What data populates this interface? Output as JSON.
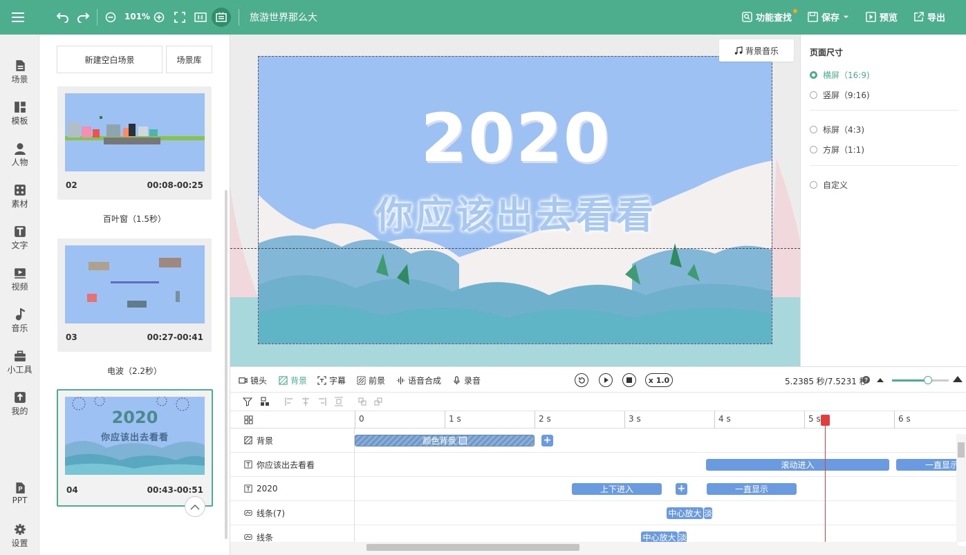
{
  "topbar": {
    "zoom": "101%",
    "doc_title": "旅游世界那么大",
    "feature_search": "功能查找",
    "save": "保存",
    "preview": "预览",
    "export": "导出"
  },
  "nav": [
    {
      "label": "场景",
      "icon": "scene-icon"
    },
    {
      "label": "模板",
      "icon": "template-icon"
    },
    {
      "label": "人物",
      "icon": "person-icon"
    },
    {
      "label": "素材",
      "icon": "material-icon"
    },
    {
      "label": "文字",
      "icon": "text-icon"
    },
    {
      "label": "视频",
      "icon": "video-icon"
    },
    {
      "label": "音乐",
      "icon": "music-icon"
    },
    {
      "label": "小工具",
      "icon": "toolbox-icon"
    },
    {
      "label": "我的",
      "icon": "upload-icon"
    },
    {
      "label": "PPT",
      "icon": "ppt-icon"
    },
    {
      "label": "设置",
      "icon": "gear-icon"
    }
  ],
  "scenes": {
    "new_blank": "新建空白场景",
    "library": "场景库",
    "cards": [
      {
        "num": "02",
        "time": "00:08-00:25",
        "transition": "百叶窗（1.5秒）"
      },
      {
        "num": "03",
        "time": "00:27-00:41",
        "transition": "电波（2.2秒）"
      },
      {
        "num": "04",
        "time": "00:43-00:51",
        "transition": ""
      }
    ],
    "thumb4_title": "2020",
    "thumb4_sub": "你应该出去看看"
  },
  "canvas": {
    "bg_music": "背景音乐",
    "big_title": "2020",
    "subtitle": "你应该出去看看"
  },
  "page_size": {
    "title": "页面尺寸",
    "options": [
      "横屏（16:9)",
      "竖屏（9:16)",
      "标屏（4:3)",
      "方屏（1:1)",
      "自定义"
    ],
    "selected": 0
  },
  "timeline": {
    "tabs": [
      "镜头",
      "背景",
      "字幕",
      "前景",
      "语音合成",
      "录音"
    ],
    "active_tab": 1,
    "speed": "x 1.0",
    "time_readout": "5.2385 秒/7.5231 秒",
    "ruler": [
      "0",
      "1 s",
      "2 s",
      "3 s",
      "4 s",
      "5 s",
      "6 s"
    ],
    "tracks": [
      {
        "name": "背景",
        "clips": [
          "颜色背景"
        ]
      },
      {
        "name": "你应该出去看看",
        "clips": [
          "滚动进入",
          "一直显示"
        ]
      },
      {
        "name": "2020",
        "clips": [
          "上下进入",
          "一直显示"
        ]
      },
      {
        "name": "线条(7)",
        "clips": [
          "中心放大",
          "淡"
        ]
      },
      {
        "name": "线条",
        "clips": [
          "中心放大",
          "淡"
        ]
      }
    ],
    "playhead_seconds": 5.2385
  },
  "colors": {
    "brand": "#4cae8c",
    "clip": "#6a9be0",
    "playhead": "#e23c3c",
    "stage_bg": "#9dc1f2"
  }
}
